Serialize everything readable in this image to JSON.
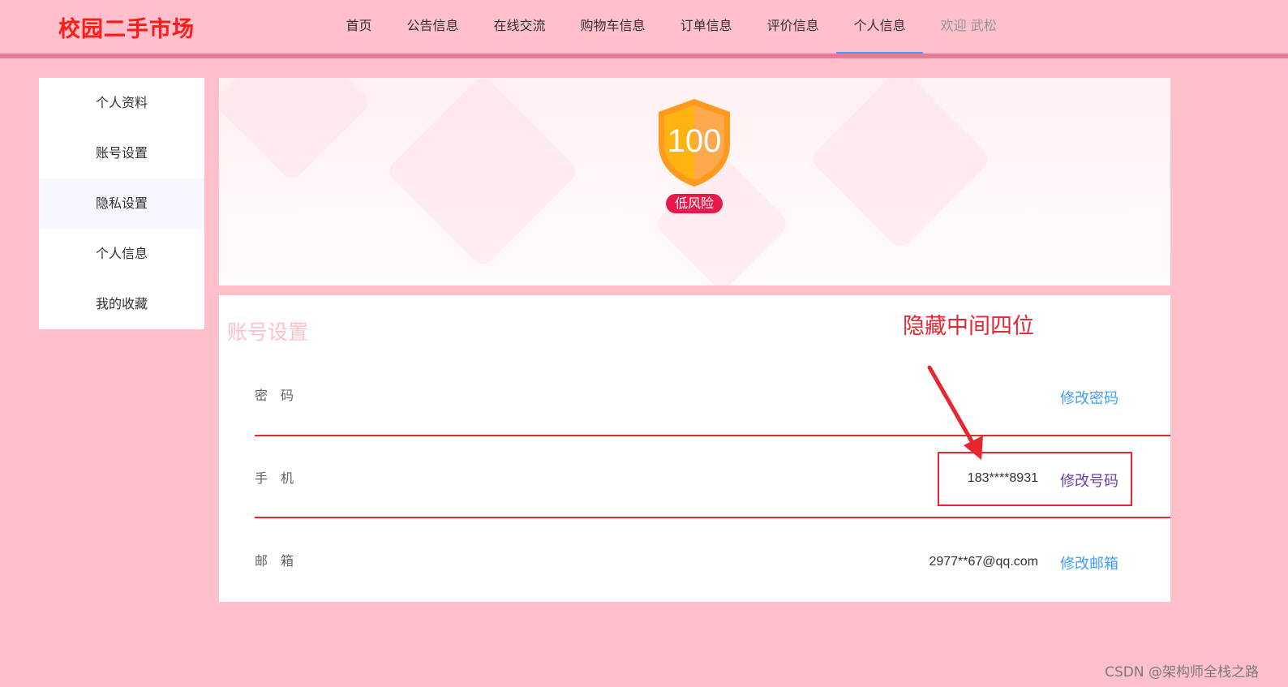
{
  "header": {
    "logo": "校园二手市场",
    "nav": [
      {
        "label": "首页"
      },
      {
        "label": "公告信息"
      },
      {
        "label": "在线交流"
      },
      {
        "label": "购物车信息"
      },
      {
        "label": "订单信息"
      },
      {
        "label": "评价信息"
      },
      {
        "label": "个人信息"
      }
    ],
    "active_nav": "个人信息",
    "welcome": "欢迎 武松"
  },
  "sidebar": {
    "items": [
      {
        "label": "个人资料"
      },
      {
        "label": "账号设置"
      },
      {
        "label": "隐私设置"
      },
      {
        "label": "个人信息"
      },
      {
        "label": "我的收藏"
      }
    ]
  },
  "security": {
    "score": "100",
    "risk_label": "低风险",
    "shield_colors": {
      "left": "#ffb310",
      "right": "#ffa94d",
      "border": "#ff9a1f"
    }
  },
  "account": {
    "title": "账号设置",
    "rows": [
      {
        "label": "密　码",
        "value": "",
        "action": "修改密码"
      },
      {
        "label": "手　机",
        "value": "183****8931",
        "action": "修改号码"
      },
      {
        "label": "邮　箱",
        "value": "2977**67@qq.com",
        "action": "修改邮箱"
      }
    ]
  },
  "annotation": {
    "text": "隐藏中间四位",
    "color": "#e82632"
  },
  "watermark": "CSDN @架构师全栈之路"
}
